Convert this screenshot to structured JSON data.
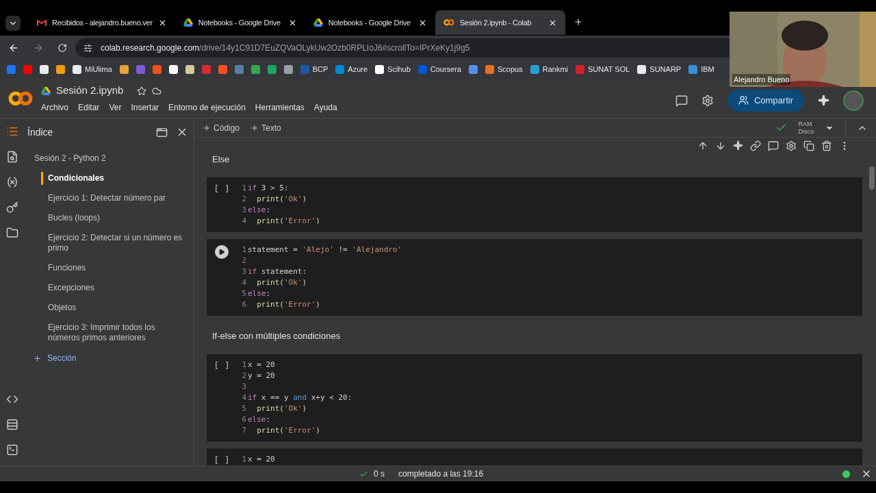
{
  "browser": {
    "tabs": [
      {
        "title": "Recibidos - alejandro.bueno.ver",
        "kind": "mail",
        "selected": false
      },
      {
        "title": "Notebooks - Google Drive",
        "kind": "drive",
        "selected": false
      },
      {
        "title": "Notebooks - Google Drive",
        "kind": "drive",
        "selected": false
      },
      {
        "title": "Sesión 2.ipynb - Colab",
        "kind": "colab",
        "selected": true
      }
    ],
    "url_host": "colab.research.google.com",
    "url_path": "/drive/14y1C91D7EuZQVaOLykUw2Ozb0RPLIoJ6#scrollTo=IPrXeKy1j9g5",
    "bookmarks": [
      {
        "color": "#1877f2"
      },
      {
        "color": "#ff0000"
      },
      {
        "color": "#e8eaed"
      },
      {
        "color": "#f39c12"
      },
      {
        "color": "#e8eaed",
        "label": "MiUlima"
      },
      {
        "color": "#e6a23c"
      },
      {
        "color": "#7b5cd6"
      },
      {
        "color": "#f4511e"
      },
      {
        "color": "#ffffff"
      },
      {
        "color": "#d9c89a"
      },
      {
        "color": "#d32f2f"
      },
      {
        "color": "#f25022"
      },
      {
        "color": "#5b7fa6"
      },
      {
        "color": "#34a853"
      },
      {
        "color": "#1ea362"
      },
      {
        "color": "#9aa0a6"
      },
      {
        "color": "#1e5aa8",
        "label": "BCP"
      },
      {
        "color": "#0089d6",
        "label": "Azure"
      },
      {
        "color": "#ffffff",
        "label": "Scihub"
      },
      {
        "color": "#0056d2",
        "label": "Coursera"
      },
      {
        "color": "#5b8def"
      },
      {
        "color": "#e9711c",
        "label": "Scopus"
      },
      {
        "color": "#2a9fd6",
        "label": "Rankmi"
      },
      {
        "color": "#d2232a",
        "label": "SUNAT SOL"
      },
      {
        "color": "#e8eaed",
        "label": "SUNARP"
      },
      {
        "color": "#3b8fd9",
        "label": "IBM"
      }
    ]
  },
  "webcam": {
    "name": "Alejandro Bueno"
  },
  "notebook": {
    "title": "Sesión 2.ipynb",
    "menu": [
      "Archivo",
      "Editar",
      "Ver",
      "Insertar",
      "Entorno de ejecución",
      "Herramientas",
      "Ayuda"
    ],
    "share": "Compartir"
  },
  "toolbar": {
    "add": [
      "Código",
      "Texto"
    ],
    "ram": "RAM",
    "disk": "Disco"
  },
  "sidebar": {
    "title": "Índice",
    "items": [
      {
        "label": "Sesión 2 - Python 2",
        "selected": false,
        "children": [
          {
            "label": "Condicionales",
            "selected": true
          },
          {
            "label": "Ejercicio 1: Detectar número par",
            "selected": false
          },
          {
            "label": "Bucles (loops)",
            "selected": false
          },
          {
            "label": "Ejercicio 2: Detectar si un número es primo",
            "selected": false
          },
          {
            "label": "Funciones",
            "selected": false
          },
          {
            "label": "Excepciones",
            "selected": false
          },
          {
            "label": "Objetos",
            "selected": false
          },
          {
            "label": "Ejercicio 3: Imprimir todos los números primos anteriores",
            "selected": false
          }
        ]
      }
    ],
    "add_section": "Sección"
  },
  "cells": [
    {
      "kind": "text",
      "text": "Else"
    },
    {
      "kind": "code",
      "hovered": false,
      "prompt": "[ ]",
      "lines": [
        {
          "n": "1",
          "tokens": [
            {
              "t": "if",
              "kind": "kw"
            },
            {
              "t": " 3 > 5:",
              "kind": "plain"
            }
          ]
        },
        {
          "n": "2",
          "tokens": [
            {
              "t": "  print",
              "kind": "fn"
            },
            {
              "t": "(",
              "kind": "plain"
            },
            {
              "t": "'Ok'",
              "kind": "str"
            },
            {
              "t": ")",
              "kind": "plain"
            }
          ]
        },
        {
          "n": "3",
          "tokens": [
            {
              "t": "else",
              "kind": "kw"
            },
            {
              "t": ":",
              "kind": "plain"
            }
          ]
        },
        {
          "n": "4",
          "tokens": [
            {
              "t": "  print",
              "kind": "fn"
            },
            {
              "t": "(",
              "kind": "plain"
            },
            {
              "t": "'Error'",
              "kind": "str"
            },
            {
              "t": ")",
              "kind": "plain"
            }
          ]
        }
      ]
    },
    {
      "kind": "code",
      "hovered": true,
      "lines": [
        {
          "n": "1",
          "tokens": [
            {
              "t": "statement = ",
              "kind": "plain"
            },
            {
              "t": "'Alejo'",
              "kind": "str"
            },
            {
              "t": " != ",
              "kind": "plain"
            },
            {
              "t": "'Alejandro'",
              "kind": "str"
            }
          ]
        },
        {
          "n": "2"
        },
        {
          "n": "3",
          "tokens": [
            {
              "t": "if",
              "kind": "kw"
            },
            {
              "t": " statement:",
              "kind": "plain"
            }
          ]
        },
        {
          "n": "4",
          "tokens": [
            {
              "t": "  print",
              "kind": "fn"
            },
            {
              "t": "(",
              "kind": "plain"
            },
            {
              "t": "'Ok'",
              "kind": "str"
            },
            {
              "t": ")",
              "kind": "plain"
            }
          ]
        },
        {
          "n": "5",
          "tokens": [
            {
              "t": "else",
              "kind": "kw"
            },
            {
              "t": ":",
              "kind": "plain"
            }
          ]
        },
        {
          "n": "6",
          "tokens": [
            {
              "t": "  print",
              "kind": "fn"
            },
            {
              "t": "(",
              "kind": "plain"
            },
            {
              "t": "'Error'",
              "kind": "str"
            },
            {
              "t": ")",
              "kind": "plain"
            }
          ]
        }
      ]
    },
    {
      "kind": "text",
      "text": "If-else con múltiples condiciones"
    },
    {
      "kind": "code",
      "hovered": false,
      "prompt": "[ ]",
      "lines": [
        {
          "n": "1",
          "tokens": [
            {
              "t": "x = 20",
              "kind": "plain"
            }
          ]
        },
        {
          "n": "2",
          "tokens": [
            {
              "t": "y = 20",
              "kind": "plain"
            }
          ]
        },
        {
          "n": "3"
        },
        {
          "n": "4",
          "tokens": [
            {
              "t": "if",
              "kind": "kw"
            },
            {
              "t": " x == y ",
              "kind": "plain"
            },
            {
              "t": "and",
              "kind": "op"
            },
            {
              "t": " x+y < 20:",
              "kind": "plain"
            }
          ]
        },
        {
          "n": "5",
          "tokens": [
            {
              "t": "  print",
              "kind": "fn"
            },
            {
              "t": "(",
              "kind": "plain"
            },
            {
              "t": "'Ok'",
              "kind": "str"
            },
            {
              "t": ")",
              "kind": "plain"
            }
          ]
        },
        {
          "n": "6",
          "tokens": [
            {
              "t": "else",
              "kind": "kw"
            },
            {
              "t": ":",
              "kind": "plain"
            }
          ]
        },
        {
          "n": "7",
          "tokens": [
            {
              "t": "  print",
              "kind": "fn"
            },
            {
              "t": "(",
              "kind": "plain"
            },
            {
              "t": "'Error'",
              "kind": "str"
            },
            {
              "t": ")",
              "kind": "plain"
            }
          ]
        }
      ]
    },
    {
      "kind": "code",
      "hovered": false,
      "prompt": "[ ]",
      "lines": [
        {
          "n": "1",
          "tokens": [
            {
              "t": "x = 20",
              "kind": "plain"
            }
          ]
        }
      ]
    }
  ],
  "status": {
    "elapsed": "0 s",
    "message": "completado a las 19:16"
  }
}
